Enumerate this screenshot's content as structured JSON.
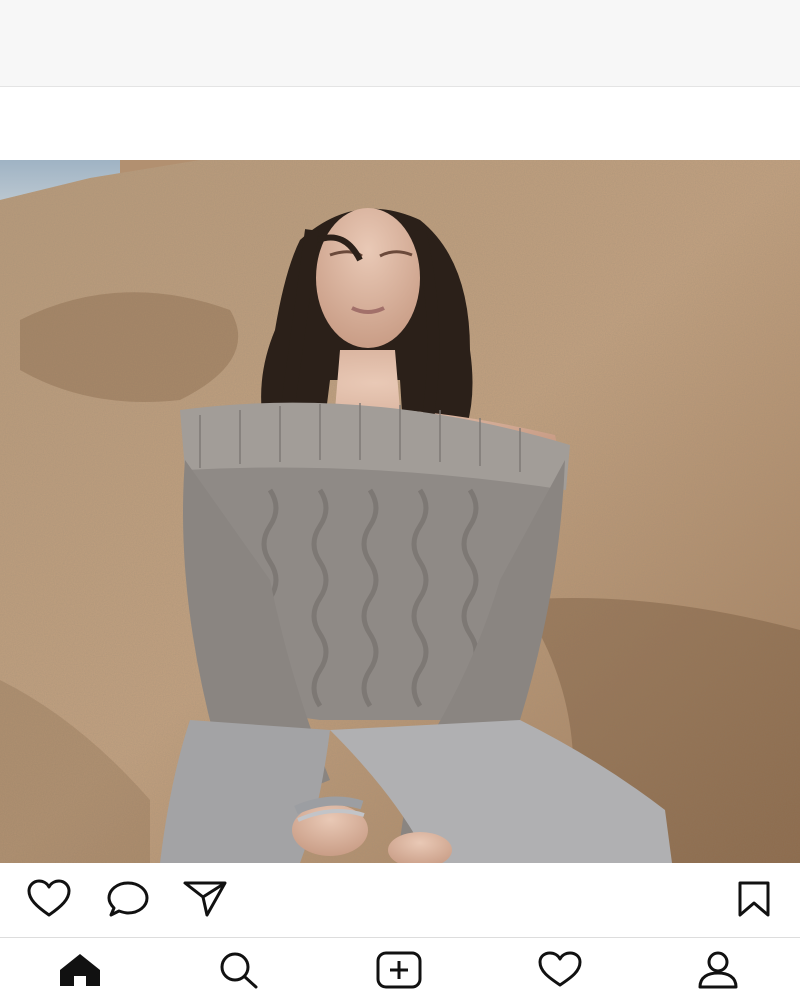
{
  "post": {
    "image_description_icon": "photo",
    "actions": [
      {
        "name": "like-icon"
      },
      {
        "name": "comment-icon"
      },
      {
        "name": "share-icon"
      },
      {
        "name": "bookmark-icon"
      }
    ]
  },
  "tab_bar": {
    "tabs": [
      {
        "name": "home-icon",
        "active": true
      },
      {
        "name": "search-icon",
        "active": false
      },
      {
        "name": "new-post-icon",
        "active": false
      },
      {
        "name": "activity-icon",
        "active": false
      },
      {
        "name": "profile-icon",
        "active": false
      }
    ]
  },
  "colors": {
    "icon": "#111111",
    "top_bar": "#f7f7f7",
    "divider": "#dddddd"
  }
}
